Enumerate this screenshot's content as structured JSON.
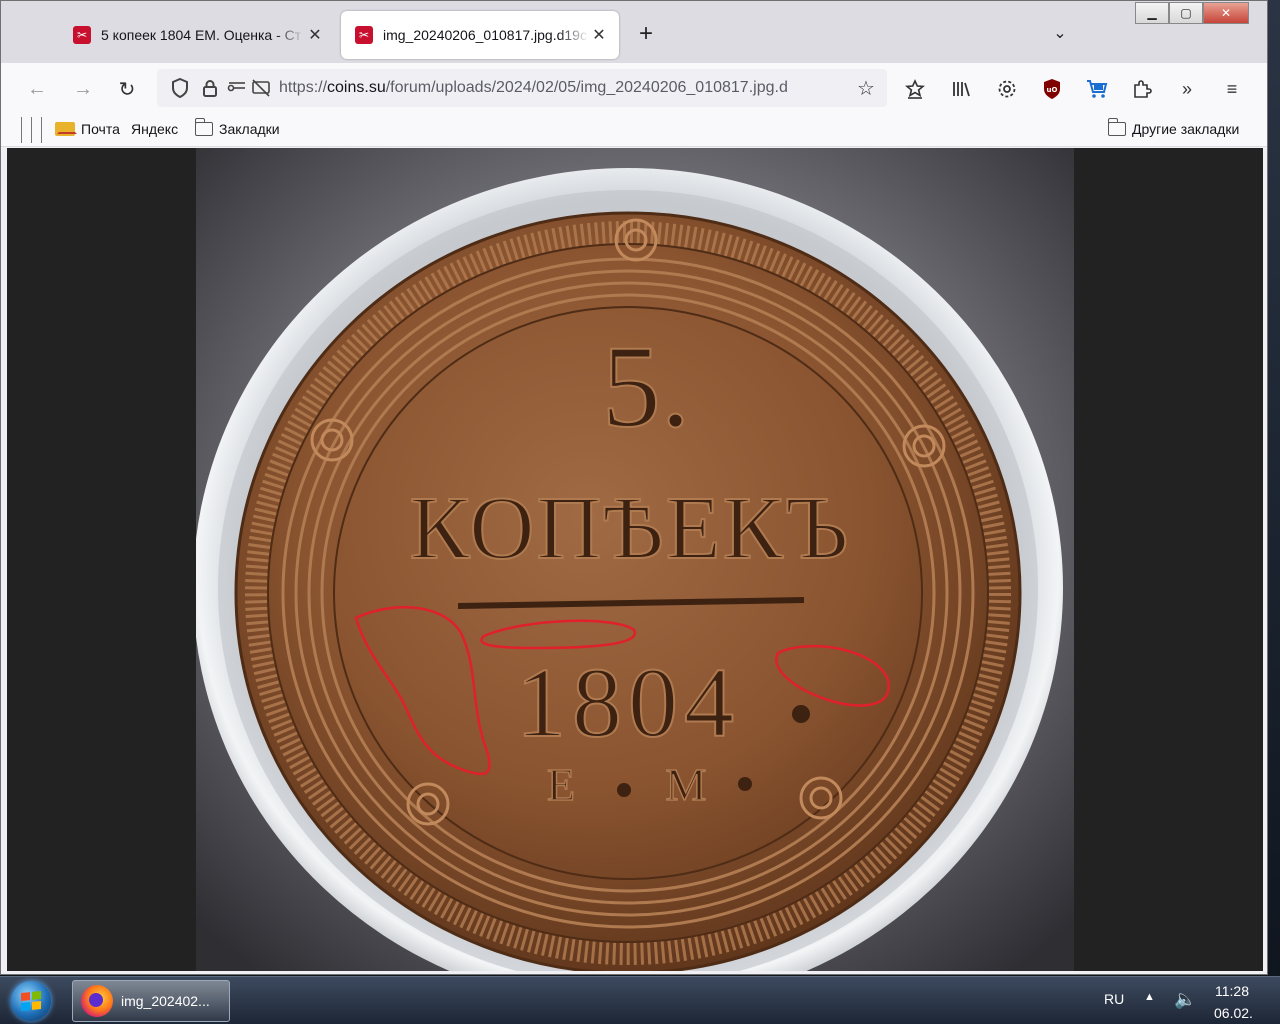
{
  "tabs": [
    {
      "title": "5 копеек 1804 ЕМ. Оценка - Ст",
      "active": false
    },
    {
      "title": "img_20240206_010817.jpg.d19c",
      "active": true
    }
  ],
  "url": {
    "scheme": "https://",
    "host": "coins.su",
    "path": "/forum/uploads/2024/02/05/img_20240206_010817.jpg.d"
  },
  "bookmarks": {
    "mail": "Почта",
    "yandex": "Яндекс",
    "folder": "Закладки",
    "other": "Другие закладки"
  },
  "coin": {
    "denomination": "5.",
    "word": "КОПѢЕКЪ",
    "year": "1804",
    "mint_e": "Е",
    "mint_m": "М",
    "colors": {
      "copper": "#8a5430",
      "copper_light": "#b07a50",
      "copper_dark": "#4f2c16",
      "marker": "#e0202a"
    }
  },
  "taskbar": {
    "task_title": "img_202402...",
    "lang": "RU",
    "time": "11:28",
    "date": "06.02."
  }
}
